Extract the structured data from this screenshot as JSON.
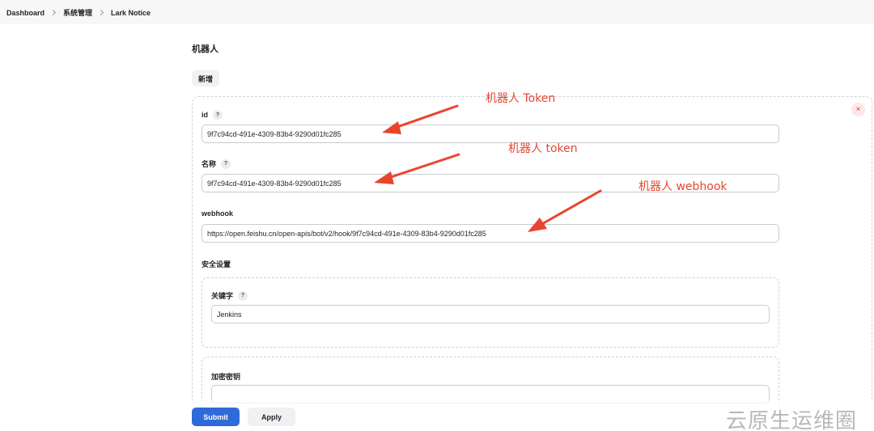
{
  "breadcrumb": {
    "items": [
      "Dashboard",
      "系统管理",
      "Lark Notice"
    ]
  },
  "section": {
    "title": "机器人",
    "add_label": "新增"
  },
  "robot": {
    "delete_label": "×",
    "id_label": "id",
    "id_value": "9f7c94cd-491e-4309-83b4-9290d01fc285",
    "name_label": "名称",
    "name_value": "9f7c94cd-491e-4309-83b4-9290d01fc285",
    "webhook_label": "webhook",
    "webhook_value": "https://open.feishu.cn/open-apis/bot/v2/hook/9f7c94cd-491e-4309-83b4-9290d01fc285",
    "security_title": "安全设置",
    "keyword_label": "关键字",
    "keyword_value": "Jenkins",
    "secret_label": "加密密钥",
    "secret_value": ""
  },
  "help_glyph": "?",
  "actions": {
    "submit_label": "Submit",
    "apply_label": "Apply"
  },
  "annotations": {
    "token_upper": "机器人 Token",
    "token_lower": "机器人 token",
    "webhook": "机器人 webhook"
  },
  "watermark": "云原生运维圈",
  "colors": {
    "annotation": "#e8452f",
    "primary": "#2f6bd8"
  }
}
